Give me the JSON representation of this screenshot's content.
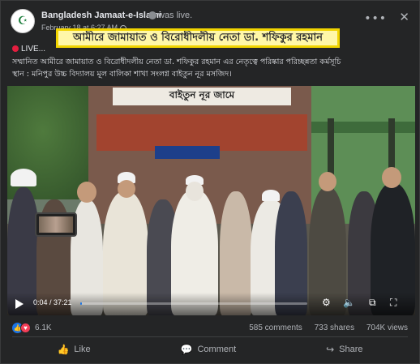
{
  "post": {
    "page_name": "Bangladesh Jamaat-e-Islami",
    "status": "was live.",
    "timestamp": "February 18 at 6:27 AM",
    "more_icon": "more-dots-icon",
    "close_icon": "close-icon",
    "live_label": "LIVE...",
    "caption_line1": "সম্মানিত আমীরে জামায়াত ও বিরোধীদলীয় নেতা ডা. শফিকুর রহমান এর নেতৃত্বে পরিষ্কার পরিচ্ছন্নতা কর্মসূচি",
    "caption_line2": "স্থান : মনিপুর উচ্চ বিদ্যালয় মূল বালিকা শাখা সংলগ্ন বাইতুন নূর মসজিদ।"
  },
  "video": {
    "headline_overlay": "আমীরে জামায়াত ও বিরোধীদলীয় নেতা ডা. শফিকুর রহমান",
    "building_sign": "বাইতুন নূর জামে",
    "time_display": "0:04 / 37:21",
    "progress_fraction": 0.0018,
    "accent_color": "#1b74e4",
    "icons": [
      "play-icon",
      "settings-icon",
      "volume-icon",
      "pip-icon",
      "fullscreen-icon"
    ]
  },
  "engagement": {
    "reaction_count": "6.1K",
    "comments": "585 comments",
    "shares": "733 shares",
    "views": "704K views"
  },
  "actions": {
    "like": "Like",
    "comment": "Comment",
    "share": "Share"
  }
}
